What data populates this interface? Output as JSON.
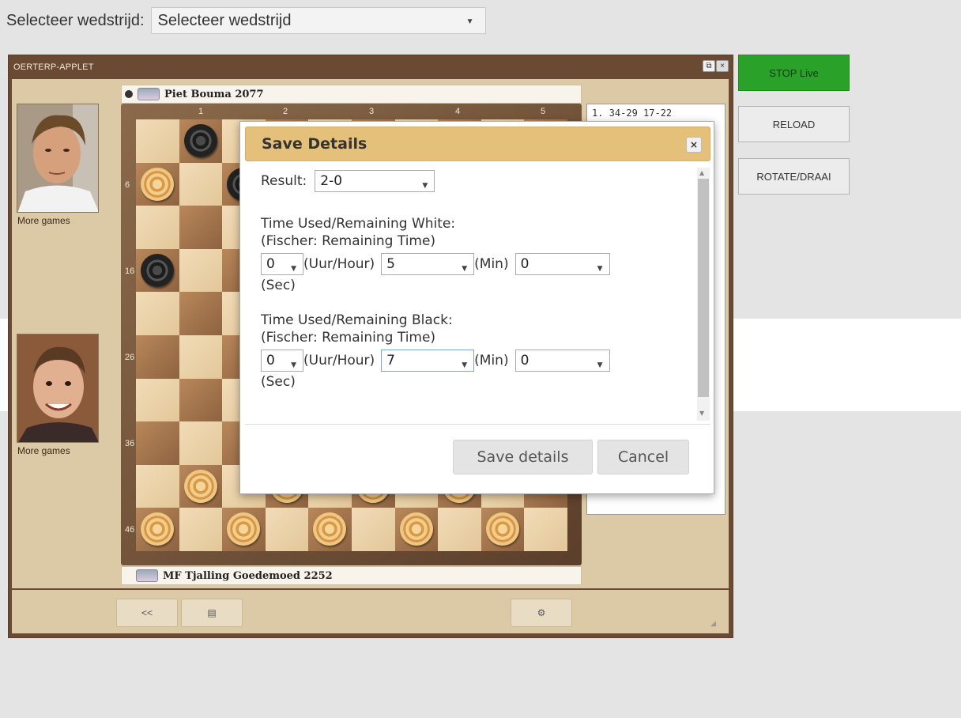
{
  "header": {
    "label": "Selecteer wedstrijd:",
    "select_value": "Selecteer wedstrijd"
  },
  "applet": {
    "title": "OERTERP-APPLET",
    "more_games_top": "More games",
    "more_games_bottom": "More games",
    "player_top": "Piet Bouma 2077",
    "player_bottom": "MF Tjalling Goedemoed 2252",
    "column_numbers": [
      "1",
      "2",
      "3",
      "4",
      "5"
    ],
    "row_numbers": [
      "6",
      "16",
      "26",
      "36",
      "46"
    ],
    "moves": [
      "1. 34-29 17-22"
    ],
    "footer_buttons": [
      "<<",
      "▤",
      "⚙"
    ]
  },
  "side_buttons": {
    "live": "STOP Live",
    "reload": "RELOAD",
    "rotate": "ROTATE/DRAAI"
  },
  "modal": {
    "title": "Save Details",
    "close": "×",
    "result_label": "Result:",
    "result_value": "2-0",
    "white_heading": "Time Used/Remaining White:",
    "white_sub": "(Fischer: Remaining Time)",
    "white_hour": "0",
    "white_min": "5",
    "white_sec": "0",
    "black_heading": "Time Used/Remaining Black:",
    "black_sub": "(Fischer: Remaining Time)",
    "black_hour": "0",
    "black_min": "7",
    "black_sec": "0",
    "hour_unit": "(Uur/Hour)",
    "min_unit": "(Min)",
    "sec_unit": "(Sec)",
    "save_button": "Save details",
    "cancel_button": "Cancel"
  },
  "colors": {
    "live_green": "#2aa22a",
    "modal_header": "#e5c07a",
    "applet_frame": "#6b4a34",
    "applet_panel": "#dcc9a5"
  }
}
